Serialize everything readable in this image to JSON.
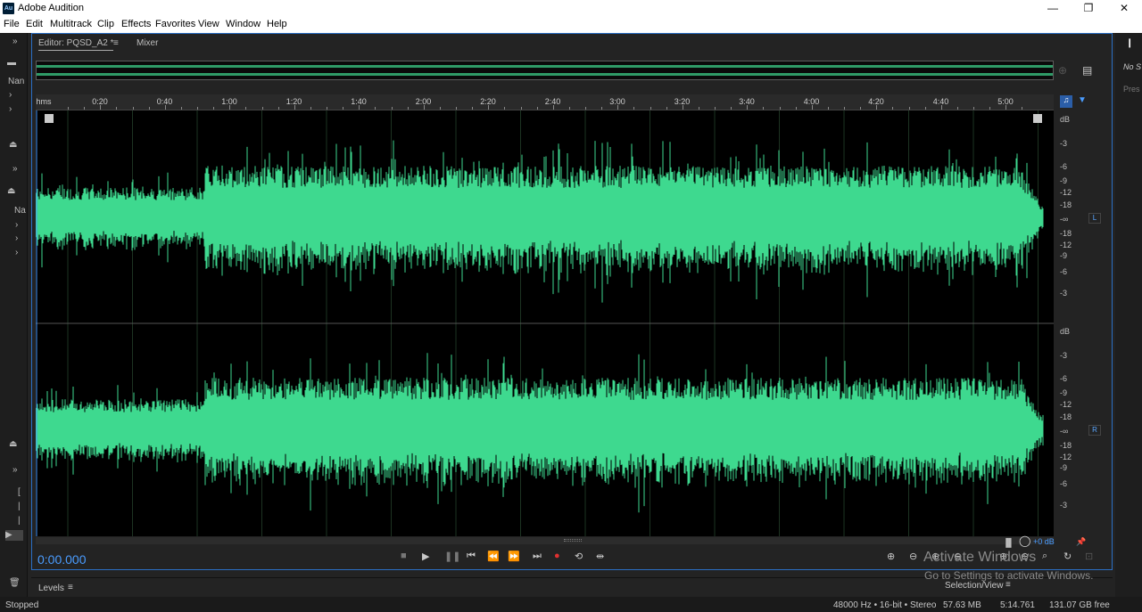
{
  "app": {
    "title": "Adobe Audition",
    "logo": "Au"
  },
  "window_controls": {
    "minimize": "—",
    "maximize": "❐",
    "close": "✕"
  },
  "menu": [
    "File",
    "Edit",
    "Multitrack",
    "Clip",
    "Effects",
    "Favorites",
    "View",
    "Window",
    "Help"
  ],
  "tabs": {
    "editor": "Editor: PQSD_A2 *",
    "mixer": "Mixer"
  },
  "ruler": {
    "unit": "hms",
    "ticks": [
      "0:20",
      "0:40",
      "1:00",
      "1:20",
      "1:40",
      "2:00",
      "2:20",
      "2:40",
      "3:00",
      "3:20",
      "3:40",
      "4:00",
      "4:20",
      "4:40",
      "5:00"
    ]
  },
  "db_top": [
    "dB",
    "-3",
    "-6",
    "-9",
    "-12",
    "-18",
    "-∞",
    "-18",
    "-12",
    "-9",
    "-6",
    "-3"
  ],
  "db_bottom": [
    "dB",
    "-3",
    "-6",
    "-9",
    "-12",
    "-18",
    "-∞",
    "-18",
    "-12",
    "-9",
    "-6",
    "-3"
  ],
  "channels": {
    "left": "L",
    "right": "R"
  },
  "waveform_color": "#3ed98f",
  "transport": {
    "time": "0:00.000",
    "gain": "+0 dB"
  },
  "panels": {
    "levels": "Levels",
    "selection": "Selection/View"
  },
  "left_panel": {
    "name1": "Nan",
    "name2": "Na"
  },
  "right_panel": {
    "label1": "No S",
    "label2": "Pres"
  },
  "status": {
    "state": "Stopped",
    "format": "48000 Hz • 16-bit • Stereo",
    "size": "57.63 MB",
    "duration": "5:14.761",
    "free": "131.07 GB free"
  },
  "watermark": {
    "line1": "Activate Windows",
    "line2": "Go to Settings to activate Windows."
  }
}
